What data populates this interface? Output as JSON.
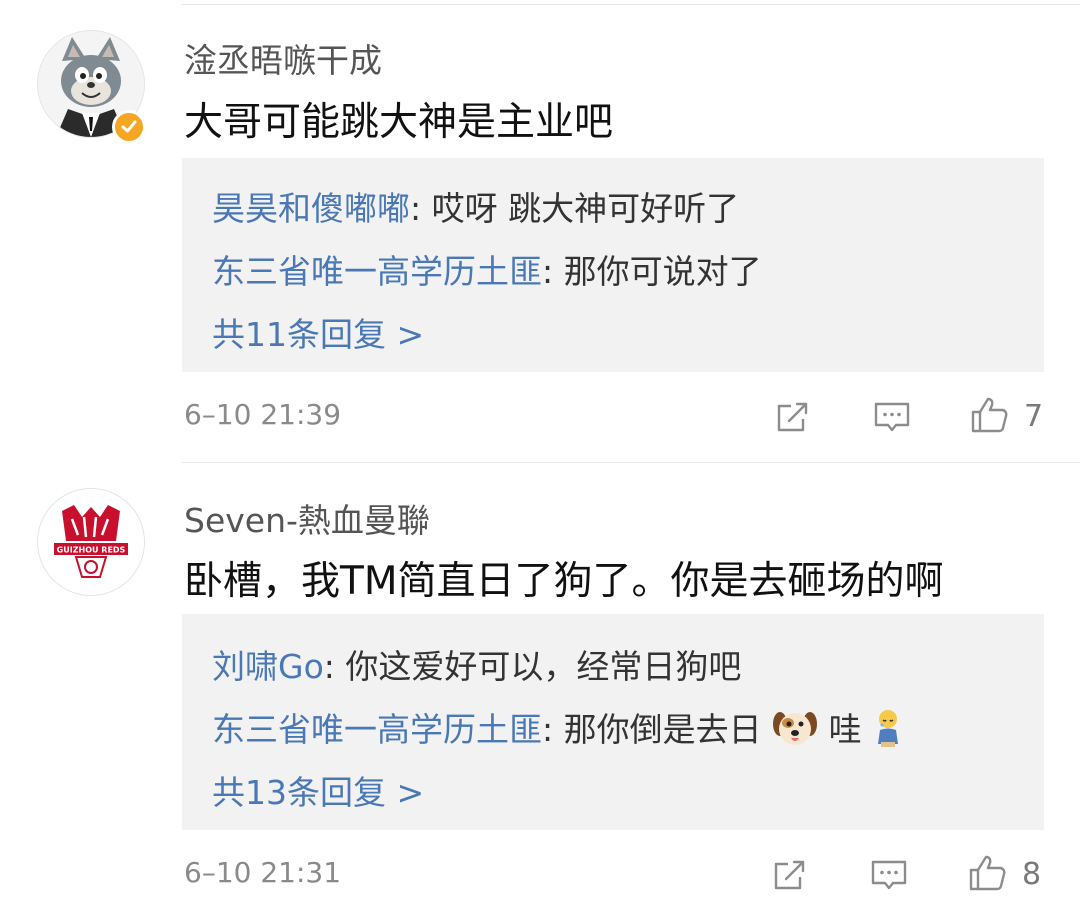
{
  "comments": [
    {
      "username": "淦丞晤嗾干成",
      "content": "大哥可能跳大神是主业吧",
      "replies": [
        {
          "user": "昊昊和傻嘟嘟",
          "sep": ": ",
          "text": "哎呀 跳大神可好听了"
        },
        {
          "user": "东三省唯一高学历土匪",
          "sep": ": ",
          "text": "那你可说对了"
        }
      ],
      "more_replies": "共11条回复 >",
      "timestamp": "6–10 21:39",
      "likes": "7",
      "avatar_icon": "cartoon-cat-avatar",
      "verified_color": "#f5a623"
    },
    {
      "username": "Seven-熱血曼聯",
      "content": "卧槽，我TM简直日了狗了。你是去砸场的啊",
      "replies": [
        {
          "user": "刘啸Go",
          "sep": ": ",
          "text": "你这爱好可以，经常日狗吧"
        },
        {
          "user": "东三省唯一高学历土匪",
          "sep": ": ",
          "text": "那你倒是去日",
          "text2": " 哇",
          "emoji1": "dog-face-emoji",
          "emoji2": "crying-figure-emoji"
        }
      ],
      "more_replies": "共13条回复 >",
      "timestamp": "6–10 21:31",
      "likes": "8",
      "avatar_icon": "guizhou-reds-logo-avatar",
      "avatar_logo_text": "GUIZHOU REDS"
    }
  ],
  "colors": {
    "link": "#4a78b4",
    "reply_bg": "#f2f2f2",
    "divider": "#e6e6e6",
    "meta": "#8a8a8a"
  },
  "icons": [
    "share-icon",
    "comment-icon",
    "like-icon"
  ]
}
